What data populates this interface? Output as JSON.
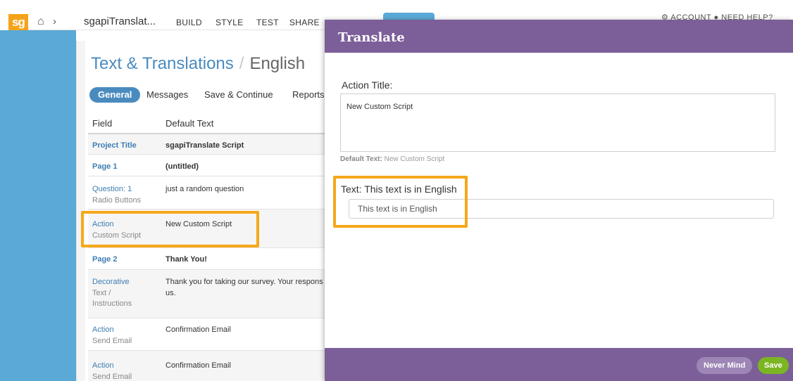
{
  "topbar": {
    "logo": "sg",
    "home_icon": "home-icon",
    "chevron": "›",
    "project_name": "sgapiTranslat...",
    "nav": [
      "BUILD",
      "STYLE",
      "TEST",
      "SHARE"
    ],
    "account_partial": "⚙ ACCOUNT      ● NEED HELP?"
  },
  "page": {
    "title": "Text & Translations",
    "separator": "/",
    "language": "English"
  },
  "tabs": [
    {
      "label": "General",
      "active": true
    },
    {
      "label": "Messages"
    },
    {
      "label": "Save & Continue"
    },
    {
      "label": "Reports"
    }
  ],
  "table": {
    "headers": [
      "Field",
      "Default Text"
    ],
    "rows": [
      {
        "field": "Project Title",
        "sub": "",
        "text": "sgapiTranslate Script",
        "bold": true
      },
      {
        "field": "Page 1",
        "sub": "",
        "text": "(untitled)",
        "bold": true
      },
      {
        "field": "Question: 1",
        "sub": "Radio Buttons",
        "text": "just a random question",
        "bold": false
      },
      {
        "field": "Action",
        "sub": "Custom Script",
        "text": "New Custom Script",
        "bold": false
      },
      {
        "field": "Page 2",
        "sub": "",
        "text": "Thank You!",
        "bold": true
      },
      {
        "field": "Decorative",
        "sub": "Text /",
        "sub2": "Instructions",
        "text": "Thank you for taking our survey. Your respons",
        "text2": "us.",
        "bold": false
      },
      {
        "field": "Action",
        "sub": "Send Email",
        "text": "Confirmation Email",
        "bold": false
      },
      {
        "field": "Action",
        "sub": "Send Email",
        "text": "Confirmation Email",
        "bold": false
      }
    ]
  },
  "modal": {
    "title": "Translate",
    "action_title_label": "Action Title:",
    "action_title_value": "New Custom Script",
    "default_text_label": "Default Text:",
    "default_text_value": "New Custom Script",
    "text_label": "Text: This text is in English",
    "text_value": "This text is in English",
    "never_mind": "Never Mind",
    "save": "Save"
  },
  "colors": {
    "accent_blue": "#4a8bbf",
    "sidebar_blue": "#5aa9d6",
    "modal_purple": "#7c5f99",
    "highlight_orange": "#f5a81a",
    "save_green": "#7bb522"
  }
}
